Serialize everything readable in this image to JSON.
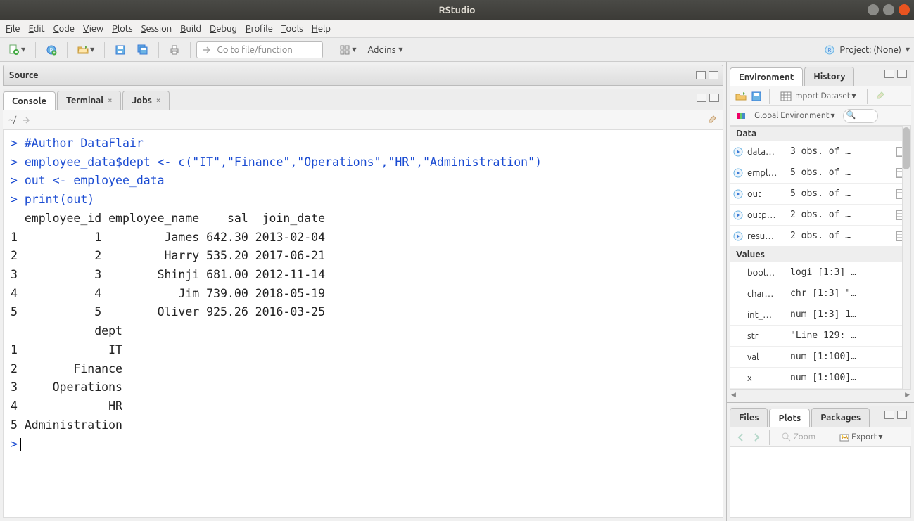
{
  "window": {
    "title": "RStudio"
  },
  "menu": {
    "file": "File",
    "edit": "Edit",
    "code": "Code",
    "view": "View",
    "plots": "Plots",
    "session": "Session",
    "build": "Build",
    "debug": "Debug",
    "profile": "Profile",
    "tools": "Tools",
    "help": "Help"
  },
  "toolbar": {
    "goto_placeholder": "Go to file/function",
    "addins": "Addins",
    "project_label": "Project: (None)"
  },
  "source_pane": {
    "title": "Source"
  },
  "console": {
    "tabs": {
      "console": "Console",
      "terminal": "Terminal",
      "jobs": "Jobs"
    },
    "cwd": "~/",
    "lines": [
      {
        "type": "cmd",
        "text": "#Author DataFlair"
      },
      {
        "type": "cmd",
        "text": "employee_data$dept <- c(\"IT\",\"Finance\",\"Operations\",\"HR\",\"Administration\")"
      },
      {
        "type": "cmd",
        "text": "out <- employee_data"
      },
      {
        "type": "cmd",
        "text": "print(out)"
      },
      {
        "type": "out",
        "text": "  employee_id employee_name    sal  join_date"
      },
      {
        "type": "out",
        "text": "1           1         James 642.30 2013-02-04"
      },
      {
        "type": "out",
        "text": "2           2         Harry 535.20 2017-06-21"
      },
      {
        "type": "out",
        "text": "3           3        Shinji 681.00 2012-11-14"
      },
      {
        "type": "out",
        "text": "4           4           Jim 739.00 2018-05-19"
      },
      {
        "type": "out",
        "text": "5           5        Oliver 925.26 2016-03-25"
      },
      {
        "type": "out",
        "text": "            dept"
      },
      {
        "type": "out",
        "text": "1             IT"
      },
      {
        "type": "out",
        "text": "2        Finance"
      },
      {
        "type": "out",
        "text": "3     Operations"
      },
      {
        "type": "out",
        "text": "4             HR"
      },
      {
        "type": "out",
        "text": "5 Administration"
      }
    ],
    "prompt": ">"
  },
  "env_pane": {
    "tabs": {
      "environment": "Environment",
      "history": "History"
    },
    "import": "Import Dataset",
    "scope": "Global Environment",
    "sections": {
      "data": "Data",
      "values": "Values"
    },
    "data_rows": [
      {
        "name": "data…",
        "val": "3 obs. of …"
      },
      {
        "name": "empl…",
        "val": "5 obs. of …"
      },
      {
        "name": "out",
        "val": "5 obs. of …"
      },
      {
        "name": "outp…",
        "val": "2 obs. of …"
      },
      {
        "name": "resu…",
        "val": "2 obs. of …"
      }
    ],
    "value_rows": [
      {
        "name": "bool…",
        "val": "logi [1:3] …"
      },
      {
        "name": "char…",
        "val": "chr [1:3] \"…"
      },
      {
        "name": "int_…",
        "val": "num [1:3] 1…"
      },
      {
        "name": "str",
        "val": "\"Line 129: …"
      },
      {
        "name": "val",
        "val": "num [1:100]…"
      },
      {
        "name": "x",
        "val": "num [1:100]…"
      }
    ]
  },
  "plots_pane": {
    "tabs": {
      "files": "Files",
      "plots": "Plots",
      "packages": "Packages"
    },
    "zoom": "Zoom",
    "export": "Export"
  }
}
